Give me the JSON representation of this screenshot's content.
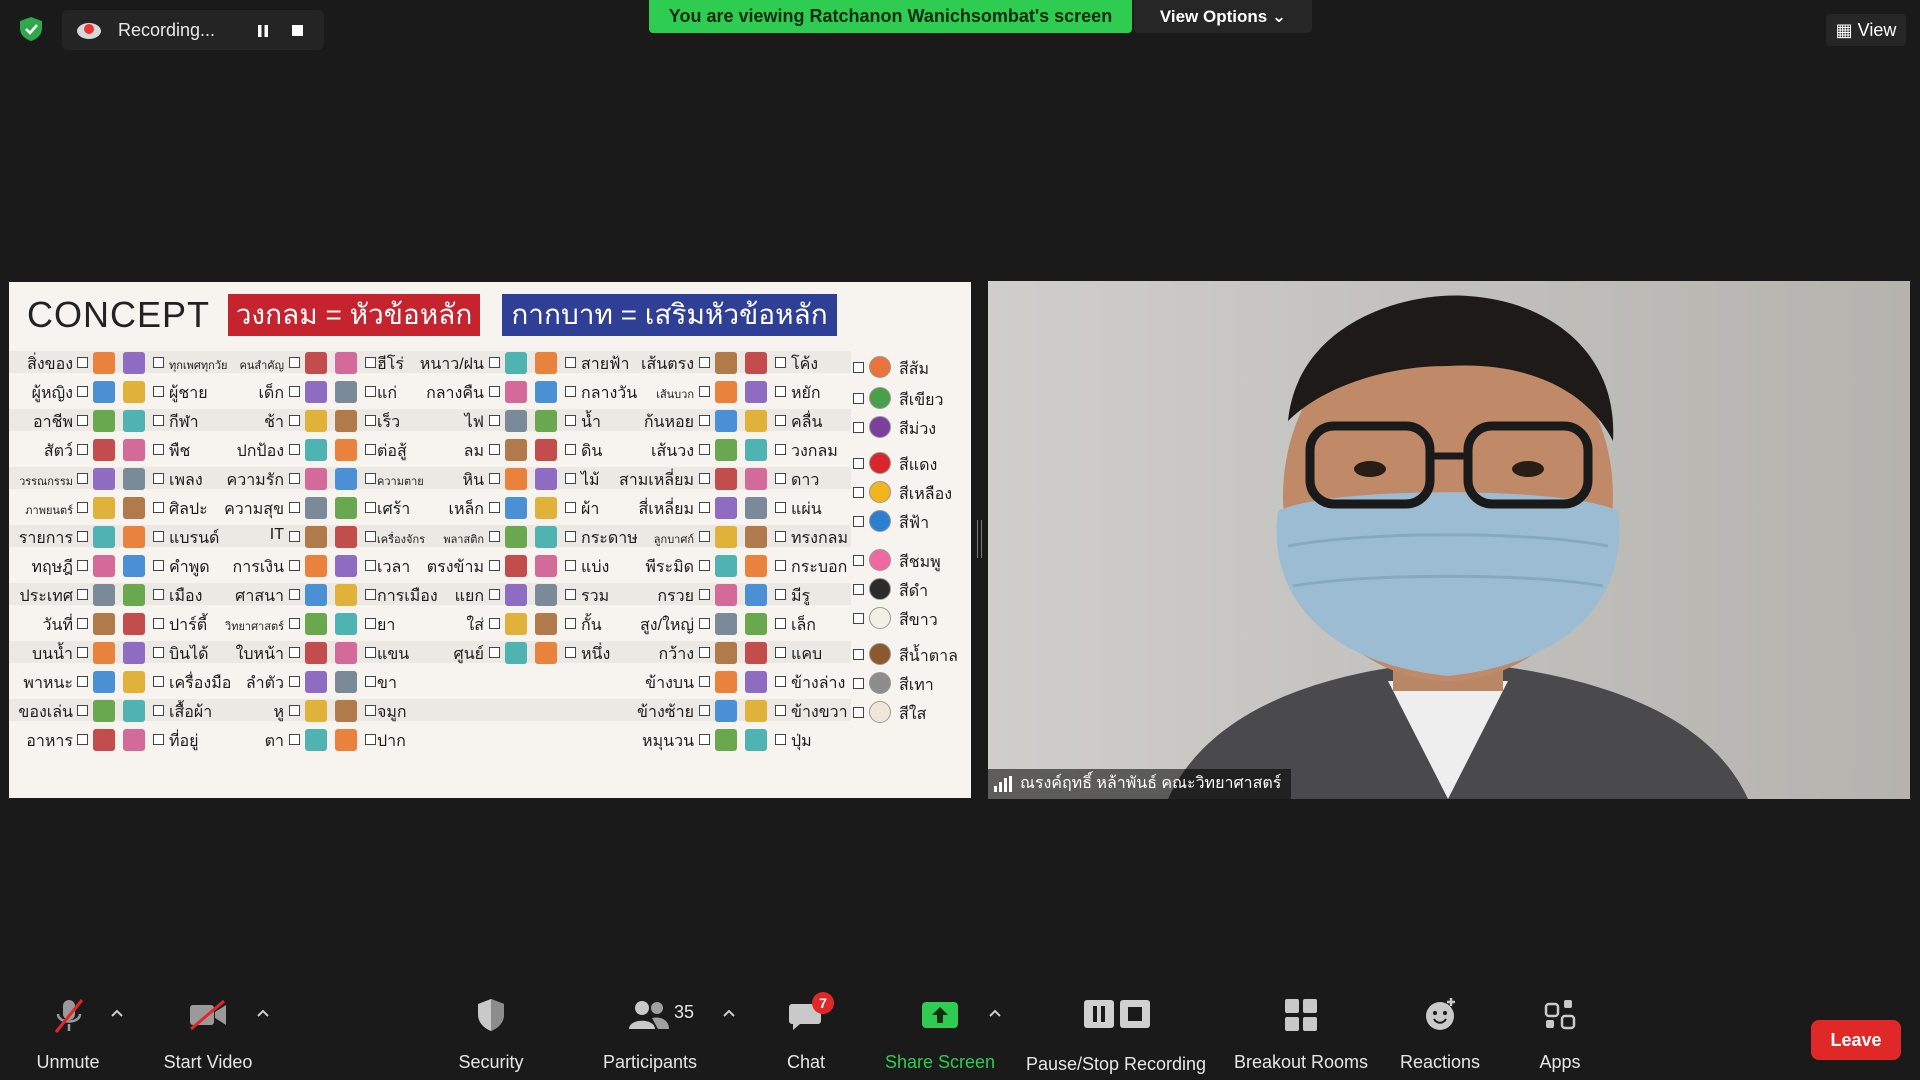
{
  "topbar": {
    "recording_label": "Recording...",
    "banner_text": "You are viewing Ratchanon Wanichsombat's screen",
    "view_options_label": "View Options",
    "view_label": "View"
  },
  "shared_screen": {
    "title": "CONCEPT",
    "header_red": "วงกลม = หัวข้อหลัก",
    "header_blue": "กากบาท = เสริมหัวข้อหลัก",
    "col1_labels": [
      "สิ่งของ",
      "ผู้หญิง",
      "อาชีพ",
      "สัตว์",
      "วรรณกรรม",
      "ภาพยนตร์",
      "รายการ",
      "ทฤษฎี",
      "ประเทศ",
      "วันที่",
      "บนน้ำ",
      "พาหนะ",
      "ของเล่น",
      "อาหาร"
    ],
    "col2_labels": [
      "ทุกเพศทุกวัย",
      "ผู้ชาย",
      "กีฬา",
      "พืช",
      "เพลง",
      "ศิลปะ",
      "แบรนด์",
      "คำพูด",
      "เมือง",
      "ปาร์ตี้",
      "บินได้",
      "เครื่องมือ",
      "เสื้อผ้า",
      "ที่อยู่"
    ],
    "col3_labels": [
      "คนสำคัญ",
      "เด็ก",
      "ช้า",
      "ปกป้อง",
      "ความรัก",
      "ความสุข",
      "IT",
      "การเงิน",
      "ศาสนา",
      "วิทยาศาสตร์",
      "ใบหน้า",
      "ลำตัว",
      "หู",
      "ตา"
    ],
    "col4_labels": [
      "ฮีโร่",
      "แก่",
      "เร็ว",
      "ต่อสู้",
      "ความตาย",
      "เศร้า",
      "เครื่องจักร",
      "เวลา",
      "การเมือง",
      "ยา",
      "แขน",
      "ขา",
      "จมูก",
      "ปาก"
    ],
    "col5_labels": [
      "หนาว/ฝน",
      "กลางคืน",
      "ไฟ",
      "ลม",
      "หิน",
      "เหล็ก",
      "พลาสติก",
      "ตรงข้าม",
      "แยก",
      "ใส่",
      "ศูนย์"
    ],
    "col6_labels": [
      "สายฟ้า",
      "กลางวัน",
      "น้ำ",
      "ดิน",
      "ไม้",
      "ผ้า",
      "กระดาษ",
      "แบ่ง",
      "รวม",
      "กั้น",
      "หนึ่ง"
    ],
    "col7_labels": [
      "เส้นตรง",
      "เส้นบวก",
      "ก้นหอย",
      "เส้นวง",
      "สามเหลี่ยม",
      "สี่เหลี่ยม",
      "ลูกบาศก์",
      "พีระมิด",
      "กรวย",
      "สูง/ใหญ่",
      "กว้าง",
      "ข้างบน",
      "ข้างซ้าย",
      "หมุนวน"
    ],
    "col8_labels": [
      "โค้ง",
      "หยัก",
      "คลื่น",
      "วงกลม",
      "ดาว",
      "แผ่น",
      "ทรงกลม",
      "กระบอก",
      "มีรู",
      "เล็ก",
      "แคบ",
      "ข้างล่าง",
      "ข้างขวา",
      "ปุ่ม"
    ],
    "colors": [
      "สีส้ม",
      "สีเขียว",
      "สีม่วง",
      "สีแดง",
      "สีเหลือง",
      "สีฟ้า",
      "สีชมพู",
      "สีดำ",
      "สีขาว",
      "สีน้ำตาล",
      "สีเทา",
      "สีใส"
    ],
    "color_swatches": [
      "#e8743b",
      "#4aa04a",
      "#7b3fa0",
      "#d9262c",
      "#f2b51c",
      "#2a7fd0",
      "#ef6aa3",
      "#2b2b2b",
      "#f3efe6",
      "#8a5a2e",
      "#8d8d8d",
      "#f0e6d8"
    ]
  },
  "participant_video": {
    "name": "ณรงค์ฤทธิ์ หล้าพันธ์ คณะวิทยาศาสตร์"
  },
  "toolbar": {
    "unmute": "Unmute",
    "start_video": "Start Video",
    "security": "Security",
    "participants": "Participants",
    "participants_count": "35",
    "chat": "Chat",
    "chat_badge": "7",
    "share_screen": "Share Screen",
    "pause_stop": "Pause/Stop Recording",
    "breakout": "Breakout Rooms",
    "reactions": "Reactions",
    "apps": "Apps",
    "leave": "Leave"
  },
  "colors": {
    "share_green": "#2ecc51",
    "leave_red": "#e02828"
  }
}
